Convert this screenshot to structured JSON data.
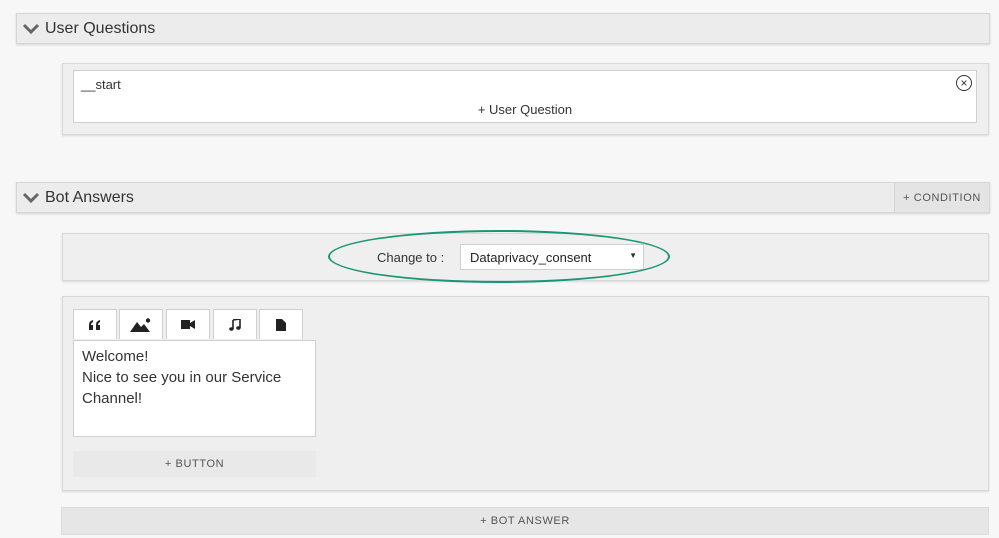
{
  "user_questions": {
    "title": "User Questions",
    "question_value": "__start",
    "add_label": "+ User Question"
  },
  "bot_answers": {
    "title": "Bot Answers",
    "condition_label": "+ CONDITION",
    "change_to_label": "Change to :",
    "change_to_value": "Dataprivacy_consent",
    "tabs": [
      "quote-icon",
      "image-icon",
      "video-icon",
      "music-icon",
      "file-icon"
    ],
    "text_lines": [
      "Welcome!",
      "Nice to see you in our Service",
      "Channel!"
    ],
    "add_button_label": "+ BUTTON",
    "add_bot_answer_label": "+ BOT ANSWER"
  },
  "colors": {
    "highlight": "#1a9676",
    "header_bg": "#ececec",
    "panel_bg": "#efefef"
  }
}
